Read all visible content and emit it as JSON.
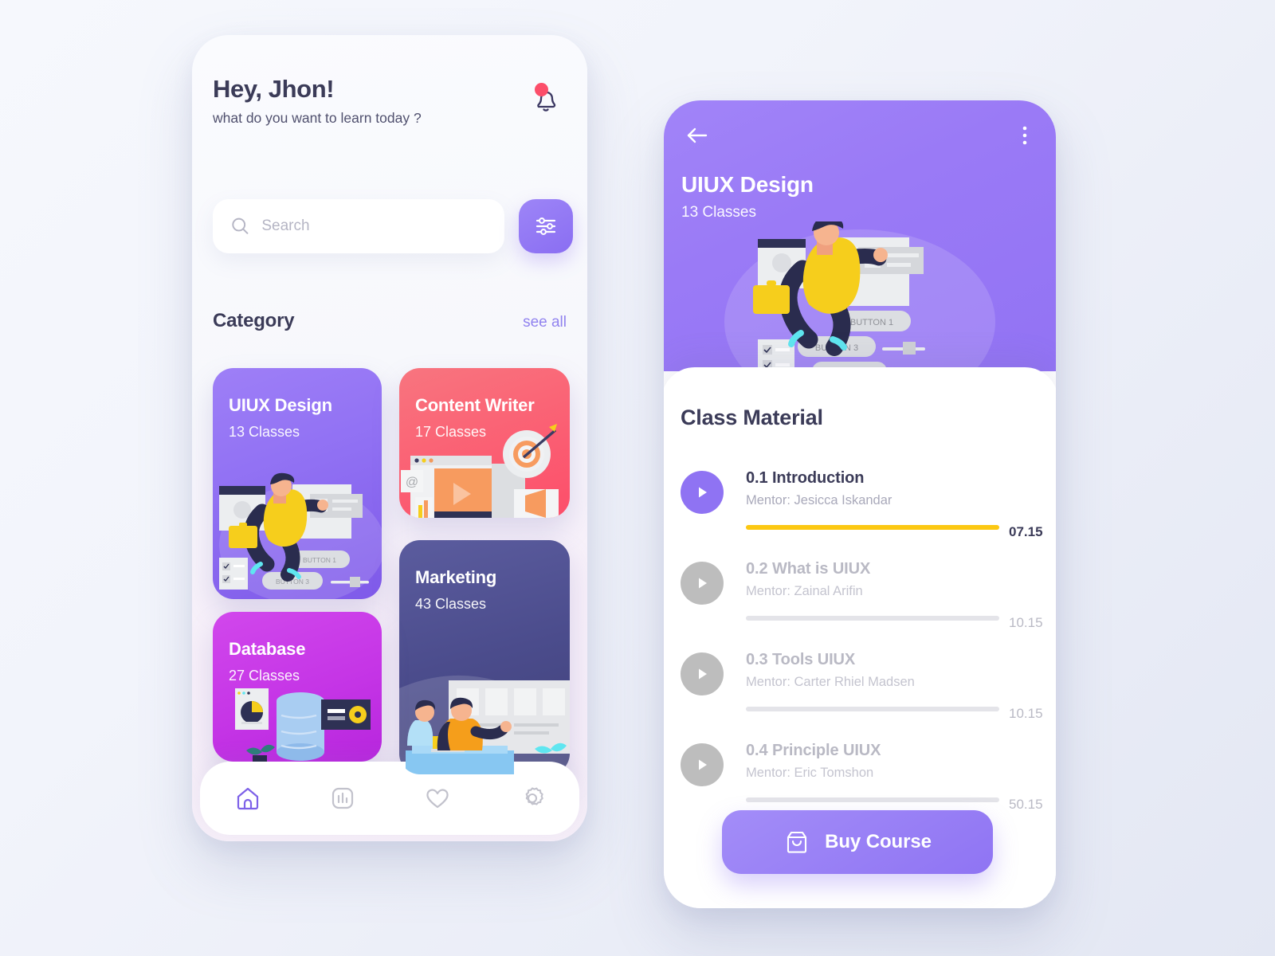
{
  "home": {
    "greeting": "Hey, Jhon!",
    "greeting_sub": "what do you want to learn today ?",
    "notification_badge": true,
    "search": {
      "placeholder": "Search",
      "value": ""
    },
    "category": {
      "title": "Category",
      "see_all_label": "see all",
      "cards": [
        {
          "title": "UIUX Design",
          "classes": "13 Classes",
          "color": "#9070f3"
        },
        {
          "title": "Content Writer",
          "classes": "17 Classes",
          "color": "#fb5f73"
        },
        {
          "title": "Marketing",
          "classes": "43 Classes",
          "color": "#4b4c8c"
        },
        {
          "title": "Database",
          "classes": "27 Classes",
          "color": "#c535e6"
        }
      ]
    },
    "tabs": [
      {
        "name": "home",
        "icon": "home-icon",
        "active": true
      },
      {
        "name": "stats",
        "icon": "chart-icon",
        "active": false
      },
      {
        "name": "favorites",
        "icon": "heart-icon",
        "active": false
      },
      {
        "name": "settings",
        "icon": "gear-icon",
        "active": false
      }
    ]
  },
  "detail": {
    "course_title": "UIUX Design",
    "course_classes": "13 Classes",
    "section_title": "Class Material",
    "illustration_labels": {
      "button1": "BUTTON 1",
      "button3": "BUTTON 3"
    },
    "lessons": [
      {
        "name": "0.1 Introduction",
        "mentor": "Mentor: Jesicca Iskandar",
        "duration": "07.15",
        "state": "active"
      },
      {
        "name": "0.2 What is UIUX",
        "mentor": "Mentor: Zainal Arifin",
        "duration": "10.15",
        "state": "idle"
      },
      {
        "name": "0.3 Tools UIUX",
        "mentor": "Mentor: Carter Rhiel Madsen",
        "duration": "10.15",
        "state": "idle"
      },
      {
        "name": "0.4 Principle UIUX",
        "mentor": "Mentor: Eric Tomshon",
        "duration": "50.15",
        "state": "idle"
      }
    ],
    "buy_label": "Buy Course"
  },
  "colors": {
    "accent_purple": "#8f74f3",
    "accent_pink": "#fc4e6a",
    "accent_yellow": "#fcc812",
    "text_dark": "#3b3b58",
    "text_muted": "#b9b9c4"
  }
}
